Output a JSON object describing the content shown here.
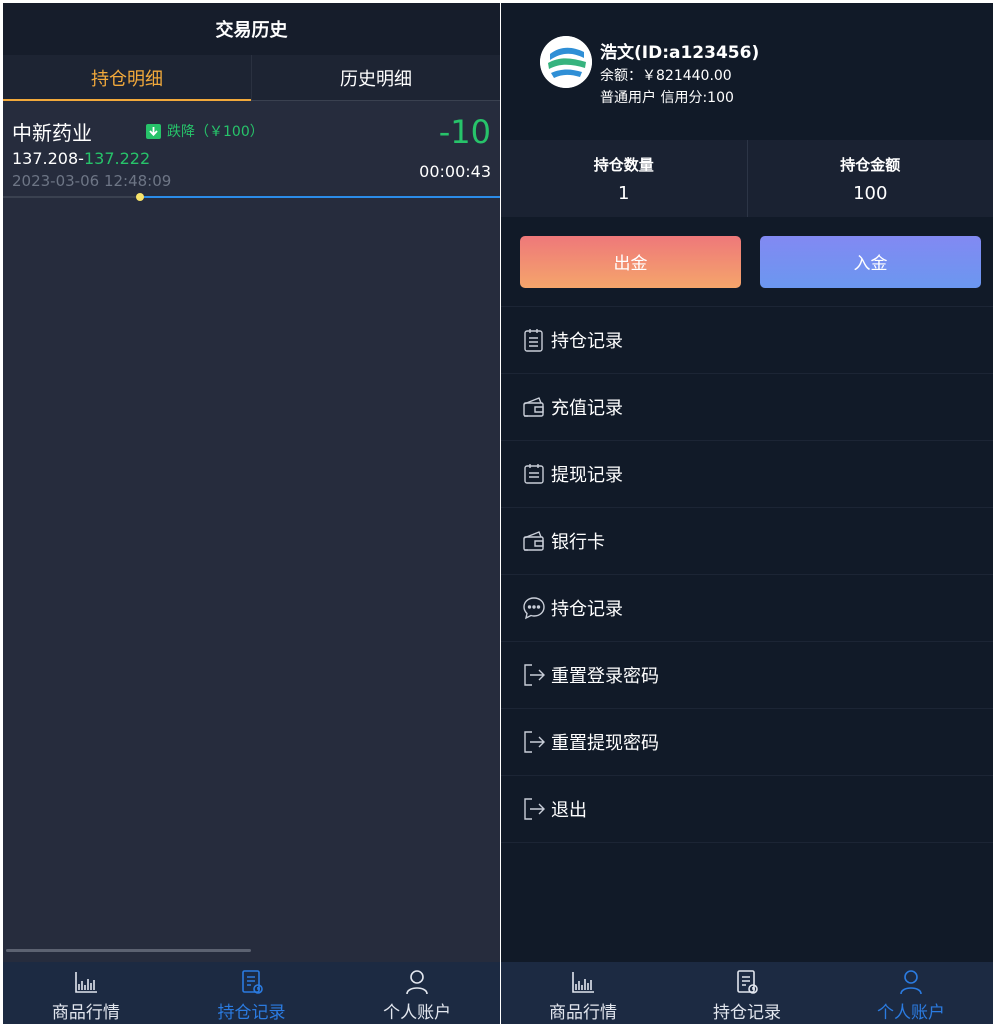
{
  "left": {
    "header_title": "交易历史",
    "tabs": [
      {
        "label": "持仓明细",
        "active": true
      },
      {
        "label": "历史明细",
        "active": false
      }
    ],
    "position": {
      "name": "中新药业",
      "direction": "跌降",
      "amount": "（￥100）",
      "pnl": "-10",
      "open_price": "137.208",
      "separator": "-",
      "current_price": "137.222",
      "open_time": "2023-03-06 12:48:09",
      "countdown": "00:00:43"
    }
  },
  "right": {
    "user": {
      "name": "浩文(ID:a123456)",
      "balance": "余额：￥821440.00",
      "level": "普通用户 信用分:100"
    },
    "stats": [
      {
        "label": "持仓数量",
        "value": "1"
      },
      {
        "label": "持仓金额",
        "value": "100"
      }
    ],
    "buttons": {
      "withdraw": "出金",
      "deposit": "入金"
    },
    "menu": [
      {
        "label": "持仓记录",
        "icon": "clipboard-icon"
      },
      {
        "label": "充值记录",
        "icon": "wallet-icon"
      },
      {
        "label": "提现记录",
        "icon": "calendar-icon"
      },
      {
        "label": "银行卡",
        "icon": "wallet-icon"
      },
      {
        "label": "持仓记录",
        "icon": "chat-icon"
      },
      {
        "label": "重置登录密码",
        "icon": "logout-icon"
      },
      {
        "label": "重置提现密码",
        "icon": "logout-icon"
      },
      {
        "label": "退出",
        "icon": "logout-icon"
      }
    ]
  },
  "tabbar": {
    "items": [
      {
        "label": "商品行情",
        "icon": "chart-icon"
      },
      {
        "label": "持仓记录",
        "icon": "record-icon"
      },
      {
        "label": "个人账户",
        "icon": "user-icon"
      }
    ],
    "left_active": 1,
    "right_active": 2
  },
  "colors": {
    "accent_orange": "#f2a93b",
    "down_green": "#27c36a",
    "active_blue": "#2b7be0",
    "withdraw_btn": "#f08a72",
    "deposit_btn": "#7690f1"
  }
}
